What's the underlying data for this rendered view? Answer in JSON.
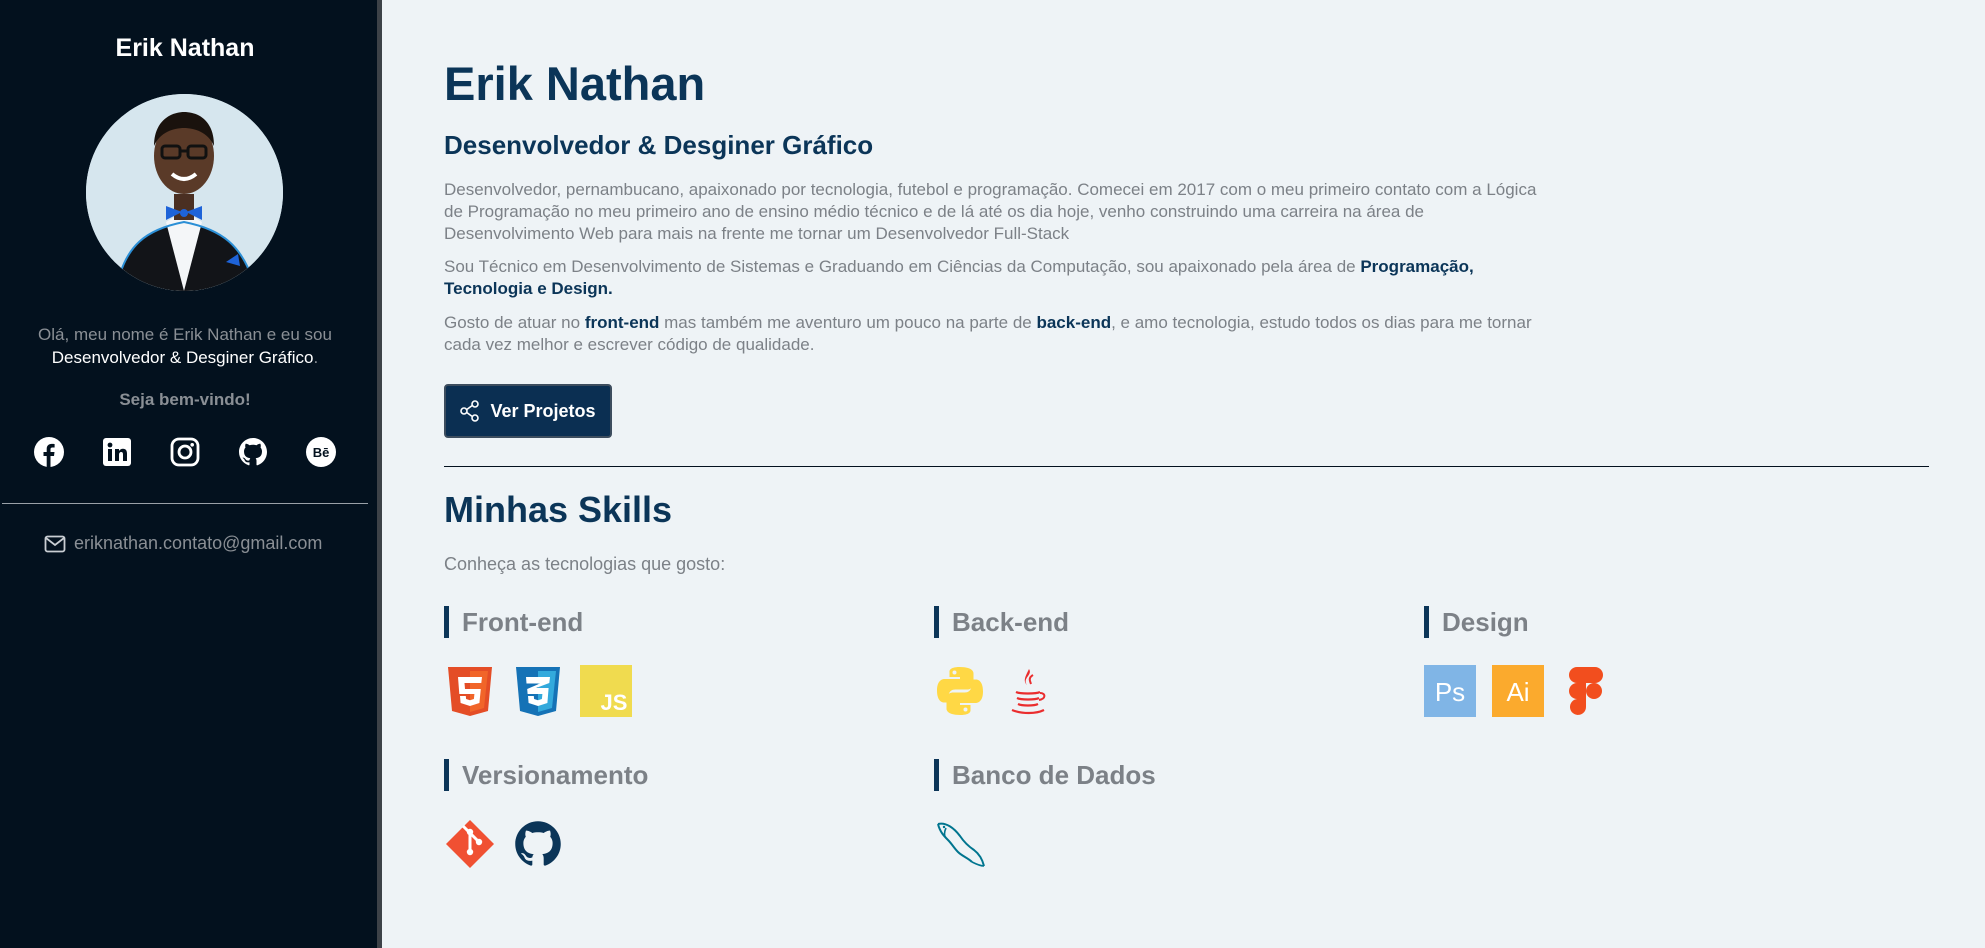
{
  "sidebar": {
    "name": "Erik Nathan",
    "greeting_text": "Olá, meu nome é Erik Nathan e eu sou",
    "greeting_role": "Desenvolvedor & Desginer Gráfico",
    "greeting_end": ".",
    "welcome": "Seja bem-vindo!",
    "socials": [
      "facebook-icon",
      "linkedin-icon",
      "instagram-icon",
      "github-icon",
      "behance-icon"
    ],
    "email": "eriknathan.contato@gmail.com"
  },
  "main": {
    "title": "Erik Nathan",
    "subtitle": "Desenvolvedor & Desginer Gráfico",
    "p1": "Desenvolvedor, pernambucano, apaixonado por tecnologia, futebol e programação. Comecei em 2017 com o meu primeiro contato com a Lógica de Programação no meu primeiro ano de ensino médio técnico e de lá até os dia hoje, venho construindo uma carreira na área de Desenvolvimento Web para mais na frente me tornar um Desenvolvedor Full-Stack",
    "p2_text": "Sou Técnico em Desenvolvimento de Sistemas e Graduando em Ciências da Computação, sou apaixonado pela área de ",
    "p2_highlight": "Programação, Tecnologia e Design.",
    "p3_a": "Gosto de atuar no ",
    "p3_hl1": "front-end",
    "p3_b": " mas também me aventuro um pouco na parte de ",
    "p3_hl2": "back-end",
    "p3_c": ", e amo tecnologia, estudo todos os dias para me tornar cada vez melhor e escrever código de qualidade.",
    "button_label": "Ver Projetos"
  },
  "skills": {
    "title": "Minhas Skills",
    "subtitle": "Conheça as tecnologias que gosto:",
    "categories": [
      {
        "name": "Front-end",
        "icons": [
          "html5-icon",
          "css3-icon",
          "javascript-icon"
        ]
      },
      {
        "name": "Back-end",
        "icons": [
          "python-icon",
          "java-icon"
        ]
      },
      {
        "name": "Design",
        "icons": [
          "photoshop-icon",
          "illustrator-icon",
          "figma-icon"
        ]
      },
      {
        "name": "Versionamento",
        "icons": [
          "git-icon",
          "github-icon"
        ]
      },
      {
        "name": "Banco de Dados",
        "icons": [
          "mysql-icon"
        ]
      }
    ]
  },
  "colors": {
    "sidebar_bg": "#03111e",
    "main_bg": "#eef3f6",
    "accent": "#0b3558",
    "muted_text": "#7c8187"
  }
}
